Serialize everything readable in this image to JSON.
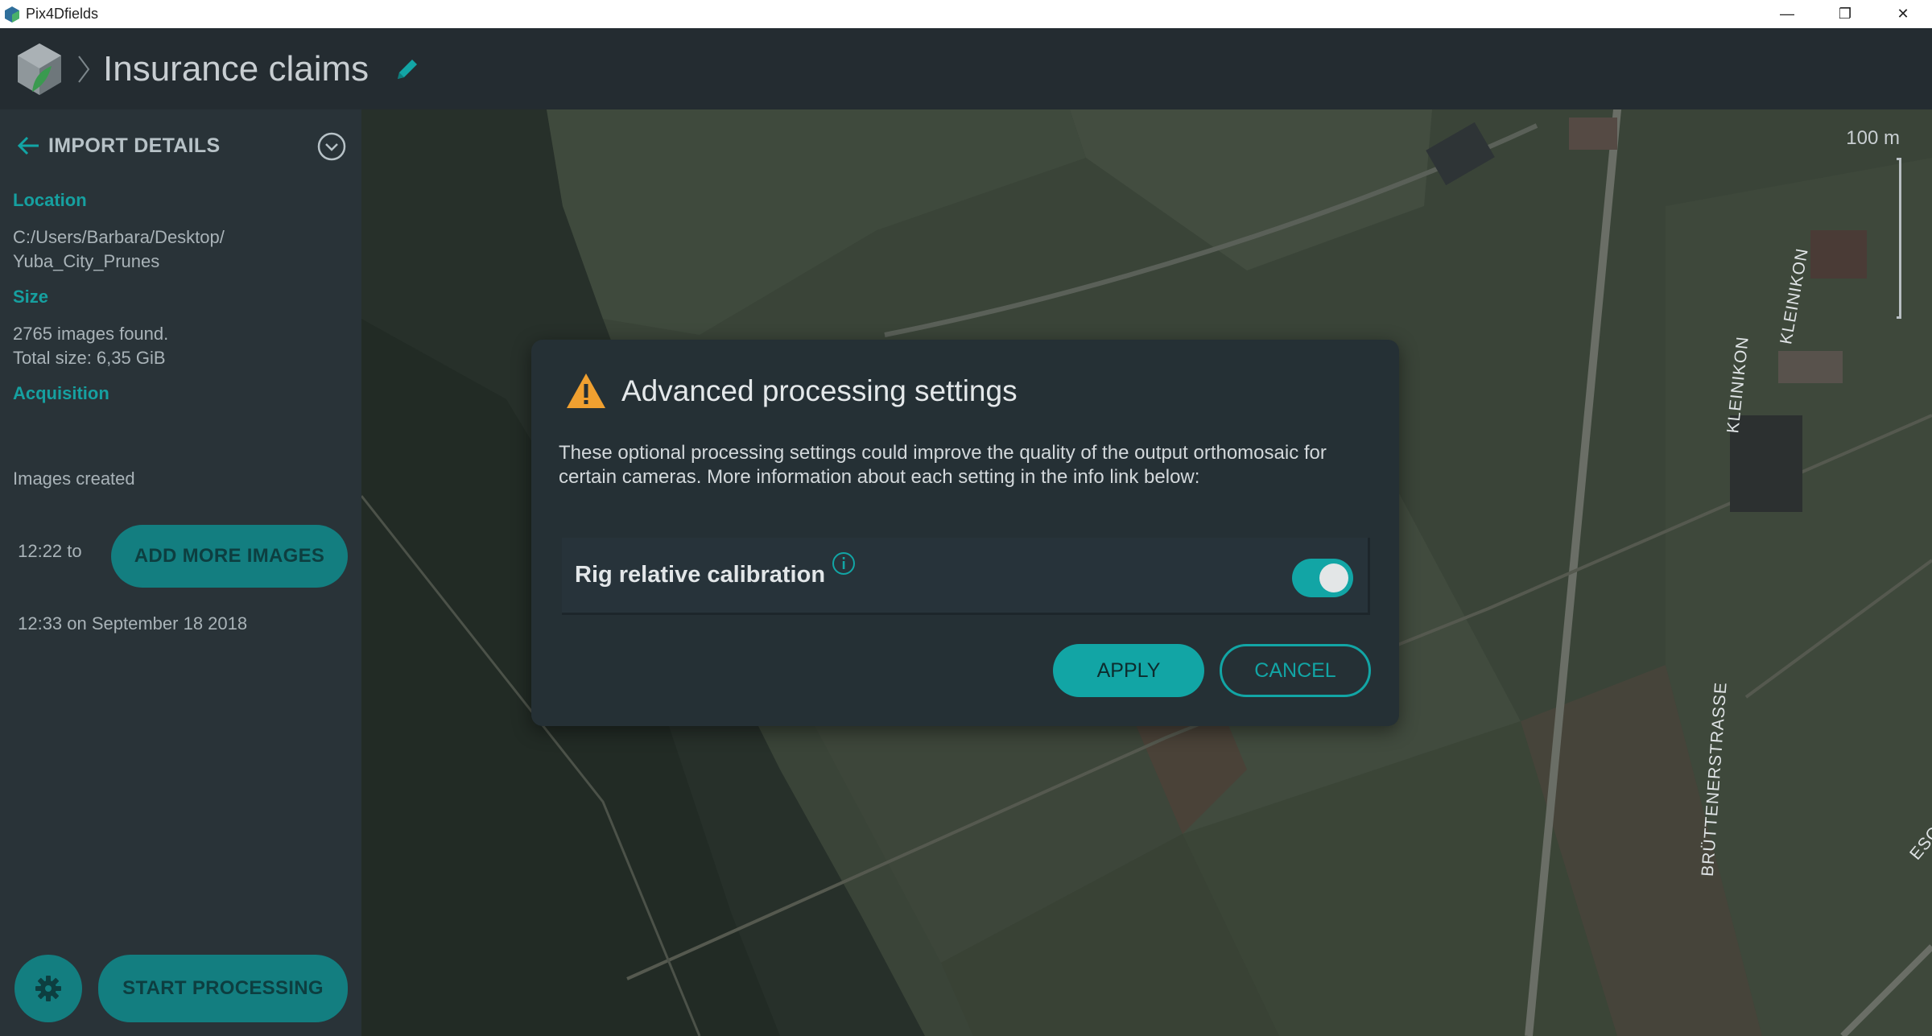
{
  "window": {
    "app_name": "Pix4Dfields",
    "minimize": "—",
    "restore": "❐",
    "close": "✕"
  },
  "header": {
    "project_title": "Insurance claims"
  },
  "sidebar": {
    "title": "IMPORT DETAILS",
    "location_label": "Location",
    "location_line1": "C:/Users/Barbara/Desktop/",
    "location_line2": "Yuba_City_Prunes",
    "size_label": "Size",
    "size_line1": "2765 images found.",
    "size_line2": "Total size: 6,35 GiB",
    "acquisition_label": "Acquisition",
    "acq_line1": "Images created",
    "acq_line2": " 12:22 to",
    "acq_line3": " 12:33 on September 18 2018",
    "add_more_button": "ADD MORE IMAGES",
    "start_button": "START PROCESSING"
  },
  "map": {
    "scale_label": "100 m",
    "streets": [
      "KLEINIKON",
      "KLEINIKON",
      "BRÜTTENERSTRASSE",
      "ESC"
    ]
  },
  "dialog": {
    "title": "Advanced processing settings",
    "body": "These optional processing settings could improve the quality of the output orthomosaic for certain cameras. More information about each setting in the info link below:",
    "setting_label": "Rig relative calibration",
    "setting_enabled": true,
    "apply_button": "APPLY",
    "cancel_button": "CANCEL"
  },
  "colors": {
    "accent": "#12a5a5",
    "warning": "#f0a030",
    "dark_panel": "#253035"
  }
}
